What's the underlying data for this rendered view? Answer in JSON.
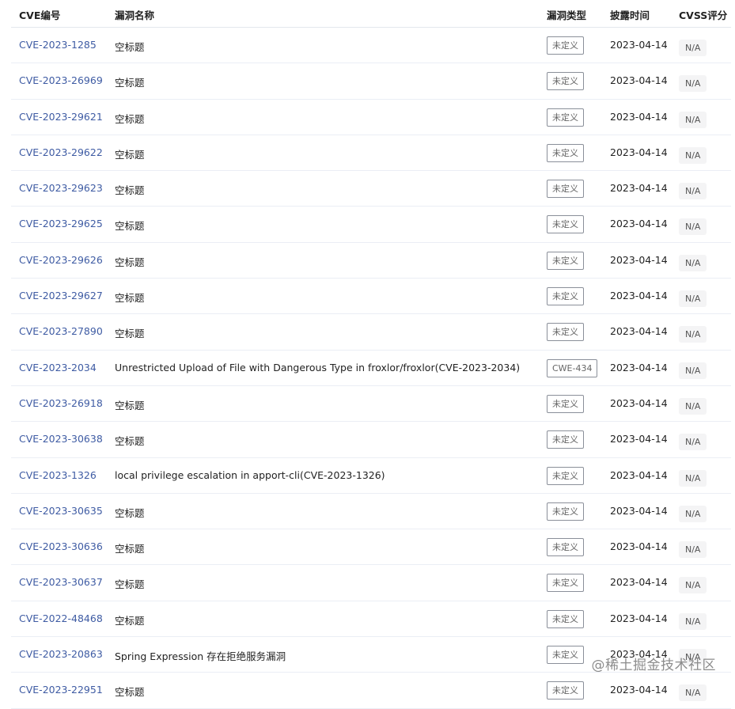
{
  "table": {
    "headers": {
      "cve_id": "CVE编号",
      "name": "漏洞名称",
      "type": "漏洞类型",
      "date": "披露时间",
      "score": "CVSS评分"
    },
    "rows": [
      {
        "cve_id": "CVE-2023-1285",
        "name": "空标题",
        "type": "未定义",
        "date": "2023-04-14",
        "score": "N/A"
      },
      {
        "cve_id": "CVE-2023-26969",
        "name": "空标题",
        "type": "未定义",
        "date": "2023-04-14",
        "score": "N/A"
      },
      {
        "cve_id": "CVE-2023-29621",
        "name": "空标题",
        "type": "未定义",
        "date": "2023-04-14",
        "score": "N/A"
      },
      {
        "cve_id": "CVE-2023-29622",
        "name": "空标题",
        "type": "未定义",
        "date": "2023-04-14",
        "score": "N/A"
      },
      {
        "cve_id": "CVE-2023-29623",
        "name": "空标题",
        "type": "未定义",
        "date": "2023-04-14",
        "score": "N/A"
      },
      {
        "cve_id": "CVE-2023-29625",
        "name": "空标题",
        "type": "未定义",
        "date": "2023-04-14",
        "score": "N/A"
      },
      {
        "cve_id": "CVE-2023-29626",
        "name": "空标题",
        "type": "未定义",
        "date": "2023-04-14",
        "score": "N/A"
      },
      {
        "cve_id": "CVE-2023-29627",
        "name": "空标题",
        "type": "未定义",
        "date": "2023-04-14",
        "score": "N/A"
      },
      {
        "cve_id": "CVE-2023-27890",
        "name": "空标题",
        "type": "未定义",
        "date": "2023-04-14",
        "score": "N/A"
      },
      {
        "cve_id": "CVE-2023-2034",
        "name": "Unrestricted Upload of File with Dangerous Type in froxlor/froxlor(CVE-2023-2034)",
        "type": "CWE-434",
        "date": "2023-04-14",
        "score": "N/A"
      },
      {
        "cve_id": "CVE-2023-26918",
        "name": "空标题",
        "type": "未定义",
        "date": "2023-04-14",
        "score": "N/A"
      },
      {
        "cve_id": "CVE-2023-30638",
        "name": "空标题",
        "type": "未定义",
        "date": "2023-04-14",
        "score": "N/A"
      },
      {
        "cve_id": "CVE-2023-1326",
        "name": "local privilege escalation in apport-cli(CVE-2023-1326)",
        "type": "未定义",
        "date": "2023-04-14",
        "score": "N/A"
      },
      {
        "cve_id": "CVE-2023-30635",
        "name": "空标题",
        "type": "未定义",
        "date": "2023-04-14",
        "score": "N/A"
      },
      {
        "cve_id": "CVE-2023-30636",
        "name": "空标题",
        "type": "未定义",
        "date": "2023-04-14",
        "score": "N/A"
      },
      {
        "cve_id": "CVE-2023-30637",
        "name": "空标题",
        "type": "未定义",
        "date": "2023-04-14",
        "score": "N/A"
      },
      {
        "cve_id": "CVE-2022-48468",
        "name": "空标题",
        "type": "未定义",
        "date": "2023-04-14",
        "score": "N/A"
      },
      {
        "cve_id": "CVE-2023-20863",
        "name": "Spring Expression 存在拒绝服务漏洞",
        "type": "未定义",
        "date": "2023-04-14",
        "score": "N/A"
      },
      {
        "cve_id": "CVE-2023-22951",
        "name": "空标题",
        "type": "未定义",
        "date": "2023-04-14",
        "score": "N/A"
      }
    ]
  },
  "watermark": "@稀土掘金技术社区",
  "colors": {
    "link": "#3e5ba3",
    "border": "#ebeef5",
    "score_bg": "#f4f4f5"
  }
}
